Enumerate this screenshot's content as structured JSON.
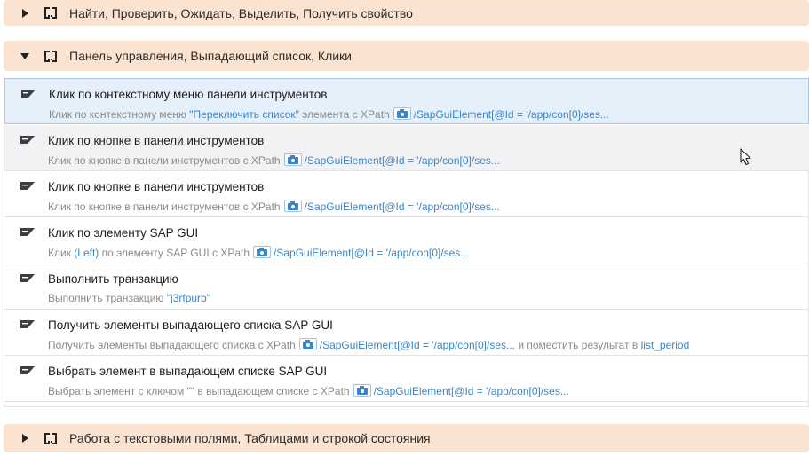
{
  "groups": {
    "top": {
      "title": "Найти, Проверить, Ожидать, Выделить, Получить свойство",
      "expanded": false
    },
    "main": {
      "title": "Панель управления, Выпадающий список, Клики",
      "expanded": true
    },
    "bottom": {
      "title": "Работа с текстовыми полями, Таблицами и строкой состояния",
      "expanded": false
    }
  },
  "actions": [
    {
      "title": "Клик по контекстному меню панели инструментов",
      "desc_prefix": "Клик по контекстному меню ",
      "desc_quoted": "\"Переключить список\"",
      "desc_mid": " элемента с XPath",
      "xpath": "/SapGuiElement[@Id = '/app/con[0]/ses...",
      "desc_suffix": "",
      "desc_suffix_link": ""
    },
    {
      "title": "Клик по кнопке в панели инструментов",
      "desc_prefix": "Клик по кнопке в панели инструментов с XPath",
      "xpath": "/SapGuiElement[@Id = '/app/con[0]/ses..."
    },
    {
      "title": "Клик по кнопке в панели инструментов",
      "desc_prefix": "Клик по кнопке в панели инструментов с XPath",
      "xpath": "/SapGuiElement[@Id = '/app/con[0]/ses..."
    },
    {
      "title": "Клик по элементу SAP GUI",
      "desc_prefix": "Клик ",
      "desc_quoted": "(Left)",
      "desc_mid": " по элементу SAP GUI с XPath",
      "xpath": "/SapGuiElement[@Id = '/app/con[0]/ses..."
    },
    {
      "title": "Выполнить транзакцию",
      "desc_prefix": "Выполнить транзакцию ",
      "desc_quoted": "\"j3rfpurb\""
    },
    {
      "title": "Получить элементы выпадающего списка SAP GUI",
      "desc_prefix": "Получить элементы выпадающего списка с XPath",
      "xpath": "/SapGuiElement[@Id = '/app/con[0]/ses...",
      "desc_suffix": " и поместить результат в ",
      "desc_suffix_link": "list_period"
    },
    {
      "title": "Выбрать элемент в выпадающем списке SAP GUI",
      "desc_prefix": "Выбрать элемент с ключом \"\" в выпадающем списке с XPath",
      "xpath": "/SapGuiElement[@Id = '/app/con[0]/ses..."
    }
  ],
  "colors": {
    "group_bg": "#fbe3d2",
    "link": "#3a86c9",
    "selected_bg": "#e6f0fb"
  },
  "icons": {
    "action": "sap-logo-icon",
    "screenshot": "camera-icon"
  }
}
